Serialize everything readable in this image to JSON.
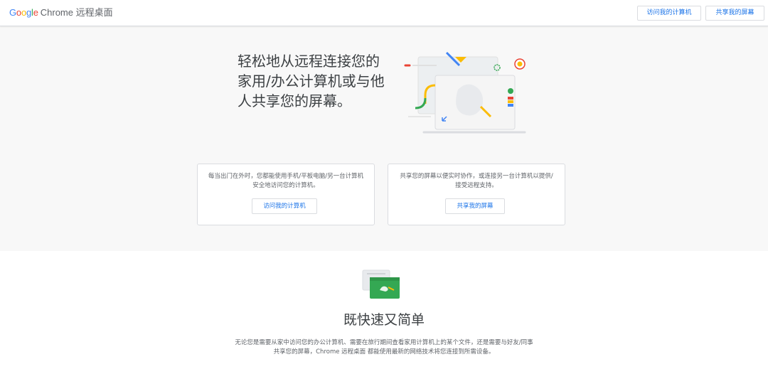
{
  "header": {
    "logo_word": "Google",
    "product_name": "Chrome 远程桌面",
    "buttons": {
      "access": "访问我的计算机",
      "share": "共享我的屏幕"
    }
  },
  "hero": {
    "title_lines": [
      "轻松地从远程连接您的",
      "家用/办公计算机或与他",
      "人共享您的屏幕。"
    ]
  },
  "cards": [
    {
      "text": "每当出门在外时，您都能使用手机/平板电脑/另一台计算机安全地访问您的计算机。",
      "button": "访问我的计算机"
    },
    {
      "text": "共享您的屏幕以便实时协作，或连接另一台计算机以提供/接受远程支持。",
      "button": "共享我的屏幕"
    }
  ],
  "section": {
    "title": "既快速又简单",
    "body": "无论您是需要从家中访问您的办公计算机、需要在旅行期间查看家用计算机上的某个文件，还是需要与好友/同事共享您的屏幕，Chrome 远程桌面 都能使用最新的网络技术将您连接到所需设备。"
  },
  "colors": {
    "google_blue": "#4285F4",
    "google_red": "#EA4335",
    "google_yellow": "#FBBC05",
    "google_green": "#34A853",
    "link_blue": "#1a73e8"
  }
}
